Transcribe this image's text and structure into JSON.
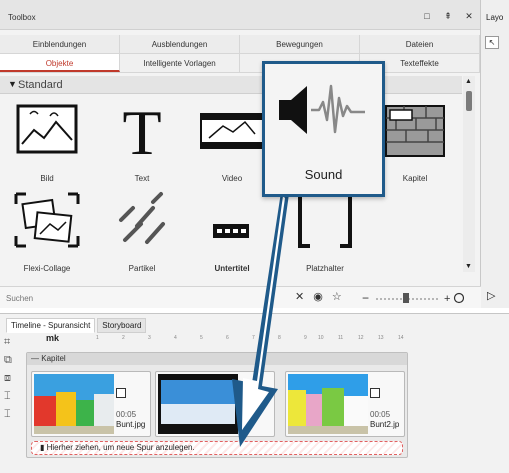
{
  "toolbox": {
    "title": "Toolbox",
    "window_buttons": [
      "□",
      "⇞",
      "✕"
    ],
    "tabs_row1": [
      "Einblendungen",
      "Ausblendungen",
      "Bewegungen",
      "Dateien"
    ],
    "tabs_row2": [
      "Objekte",
      "Intelligente Vorlagen",
      "",
      "Texteffekte"
    ],
    "active_tab": "Objekte",
    "section": "Standard",
    "objects": [
      "Bild",
      "Text",
      "Video",
      "Kapitel",
      "Flexi-Collage",
      "Partikel",
      "Untertitel",
      "Platzhalter"
    ],
    "search_placeholder": "Suchen",
    "zoom_minus": "−",
    "zoom_plus": "+"
  },
  "layout_panel": {
    "title": "Layo"
  },
  "callout": {
    "label": "Sound"
  },
  "timeline": {
    "tabs": [
      "Timeline - Spuransicht",
      "Storyboard"
    ],
    "active_tab": "Timeline - Spuransicht",
    "ruler_numbers": [
      "1",
      "2",
      "3",
      "4",
      "5",
      "6",
      "7",
      "8",
      "9",
      "10",
      "11",
      "12",
      "13",
      "14"
    ],
    "ruler_mark": "mk",
    "chapter_label": "Kapitel",
    "clips": [
      {
        "duration": "00:05",
        "name": "Bunt.jpg"
      },
      {
        "duration": "",
        "name": ""
      },
      {
        "duration": "00:05",
        "name": "Bunt2.jp"
      }
    ],
    "dropzone_text": "Hierher ziehen, um neue Spur anzulegen."
  },
  "colors": {
    "accent": "#c0392b",
    "callout_border": "#1f5a8a"
  }
}
